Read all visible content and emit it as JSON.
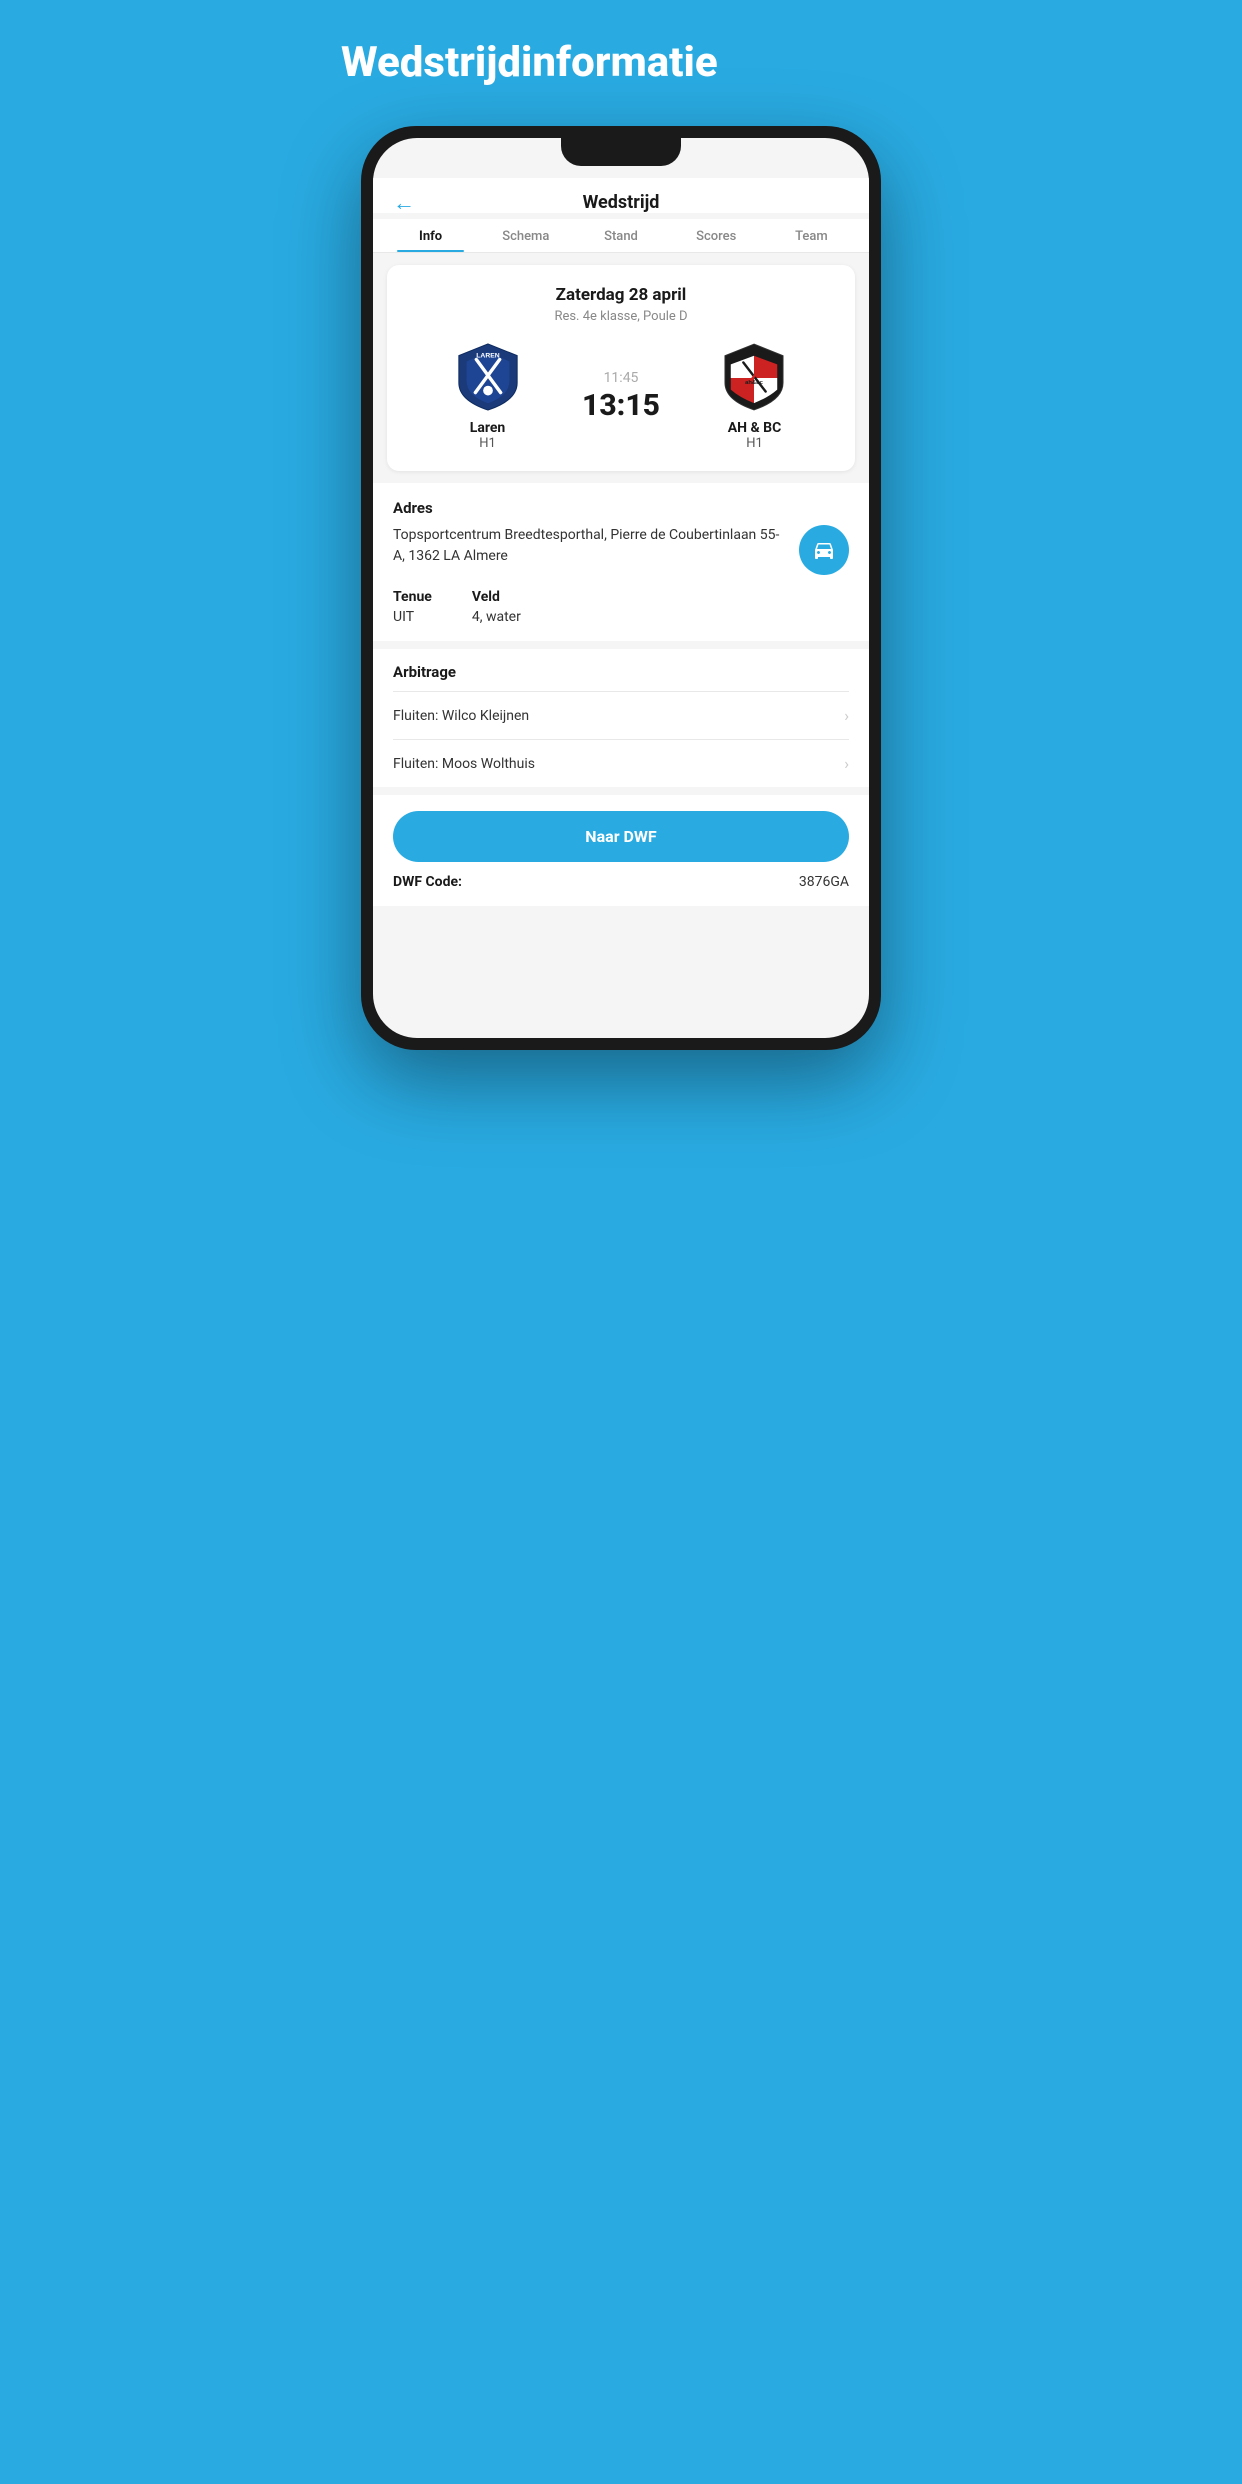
{
  "page": {
    "bg_title": "Wedstrijdinformatie"
  },
  "header": {
    "title": "Wedstrijd",
    "back_label": "←"
  },
  "tabs": [
    {
      "label": "Info",
      "active": true
    },
    {
      "label": "Schema",
      "active": false
    },
    {
      "label": "Stand",
      "active": false
    },
    {
      "label": "Scores",
      "active": false
    },
    {
      "label": "Team",
      "active": false
    }
  ],
  "match": {
    "date": "Zaterdag 28 april",
    "league": "Res. 4e klasse, Poule D",
    "time_planned": "11:45",
    "score": "13:15",
    "home_team": "Laren",
    "home_sub": "H1",
    "away_team": "AH & BC",
    "away_sub": "H1"
  },
  "address": {
    "label": "Adres",
    "text": "Topsportcentrum Breedtesporthal, Pierre de Coubertinlaan 55-A, 1362 LA Almere"
  },
  "tenue": {
    "label": "Tenue",
    "value": "UIT"
  },
  "veld": {
    "label": "Veld",
    "value": "4, water"
  },
  "arbitrage": {
    "title": "Arbitrage",
    "items": [
      {
        "text": "Fluiten: Wilco Kleijnen"
      },
      {
        "text": "Fluiten: Moos Wolthuis"
      }
    ]
  },
  "dwf": {
    "button_label": "Naar DWF",
    "code_label": "DWF Code:",
    "code_value": "3876GA"
  }
}
